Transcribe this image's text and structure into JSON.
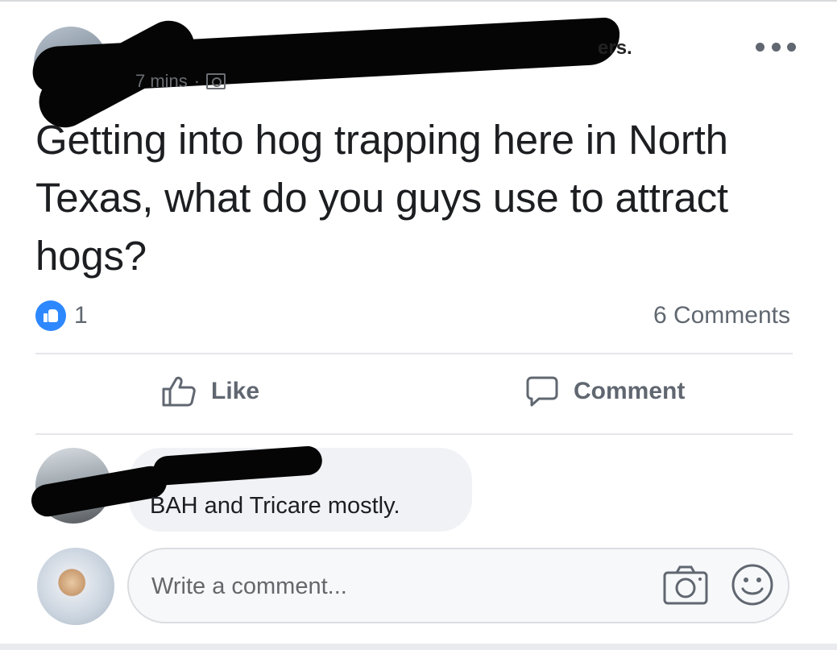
{
  "post": {
    "author_name_tail": "ers.",
    "time": "7 mins",
    "separator": "·",
    "text": "Getting into hog trapping here in North Texas, what do you guys use to attract hogs?",
    "reaction_count": "1",
    "comments_count": "6 Comments"
  },
  "actions": {
    "like_label": "Like",
    "comment_label": "Comment"
  },
  "comment": {
    "text": "BAH and Tricare mostly."
  },
  "composer": {
    "placeholder": "Write a comment..."
  },
  "icons": {
    "more": "more-horizontal-icon",
    "audience": "friends-audience-icon",
    "like_badge": "like-reaction-icon",
    "like": "thumbs-up-icon",
    "comment": "speech-bubble-icon",
    "camera": "camera-icon",
    "emoji": "smiley-icon"
  },
  "colors": {
    "accent": "#2d88ff",
    "secondary_text": "#606770",
    "bubble": "#f0f2f5"
  }
}
